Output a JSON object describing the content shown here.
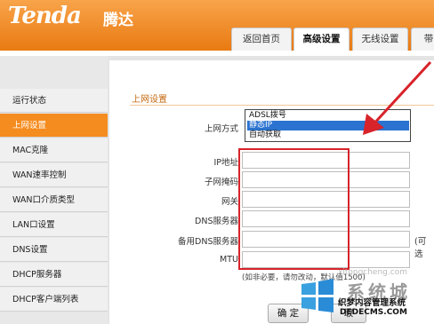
{
  "header": {
    "logo": "Tenda",
    "logo_cn": "腾达",
    "tabs": [
      {
        "label": "返回首页"
      },
      {
        "label": "高级设置"
      },
      {
        "label": "无线设置"
      },
      {
        "label": "带"
      }
    ]
  },
  "sidebar": {
    "items": [
      {
        "label": "运行状态"
      },
      {
        "label": "上网设置"
      },
      {
        "label": "MAC克隆"
      },
      {
        "label": "WAN速率控制"
      },
      {
        "label": "WAN口介质类型"
      },
      {
        "label": "LAN口设置"
      },
      {
        "label": "DNS设置"
      },
      {
        "label": "DHCP服务器"
      },
      {
        "label": "DHCP客户端列表"
      }
    ]
  },
  "content": {
    "section_title": "上网设置",
    "fields": {
      "mode_label": "上网方式",
      "ip_label": "IP地址",
      "mask_label": "子网掩码",
      "gateway_label": "网关",
      "dns_label": "DNS服务器",
      "dns2_label": "备用DNS服务器",
      "mtu_label": "MTU"
    },
    "dropdown": {
      "options": [
        "ADSL拨号",
        "静态IP",
        "自动获取"
      ],
      "selected": "静态IP"
    },
    "dns2_suffix": "(可选",
    "hint": "(如非必要，请勿改动，默认值1500)",
    "buttons": {
      "ok": "确 定",
      "cancel": "取"
    }
  },
  "watermark": {
    "brand": "系统城",
    "faint": "xitongcheng.com",
    "line1": "织梦内容管理系统",
    "line2": "DEDECMS.COM"
  },
  "colors": {
    "header_orange": "#f08418",
    "active_orange": "#f58c1f",
    "highlight_red": "#d8232a",
    "selection_blue": "#2a73d0"
  }
}
